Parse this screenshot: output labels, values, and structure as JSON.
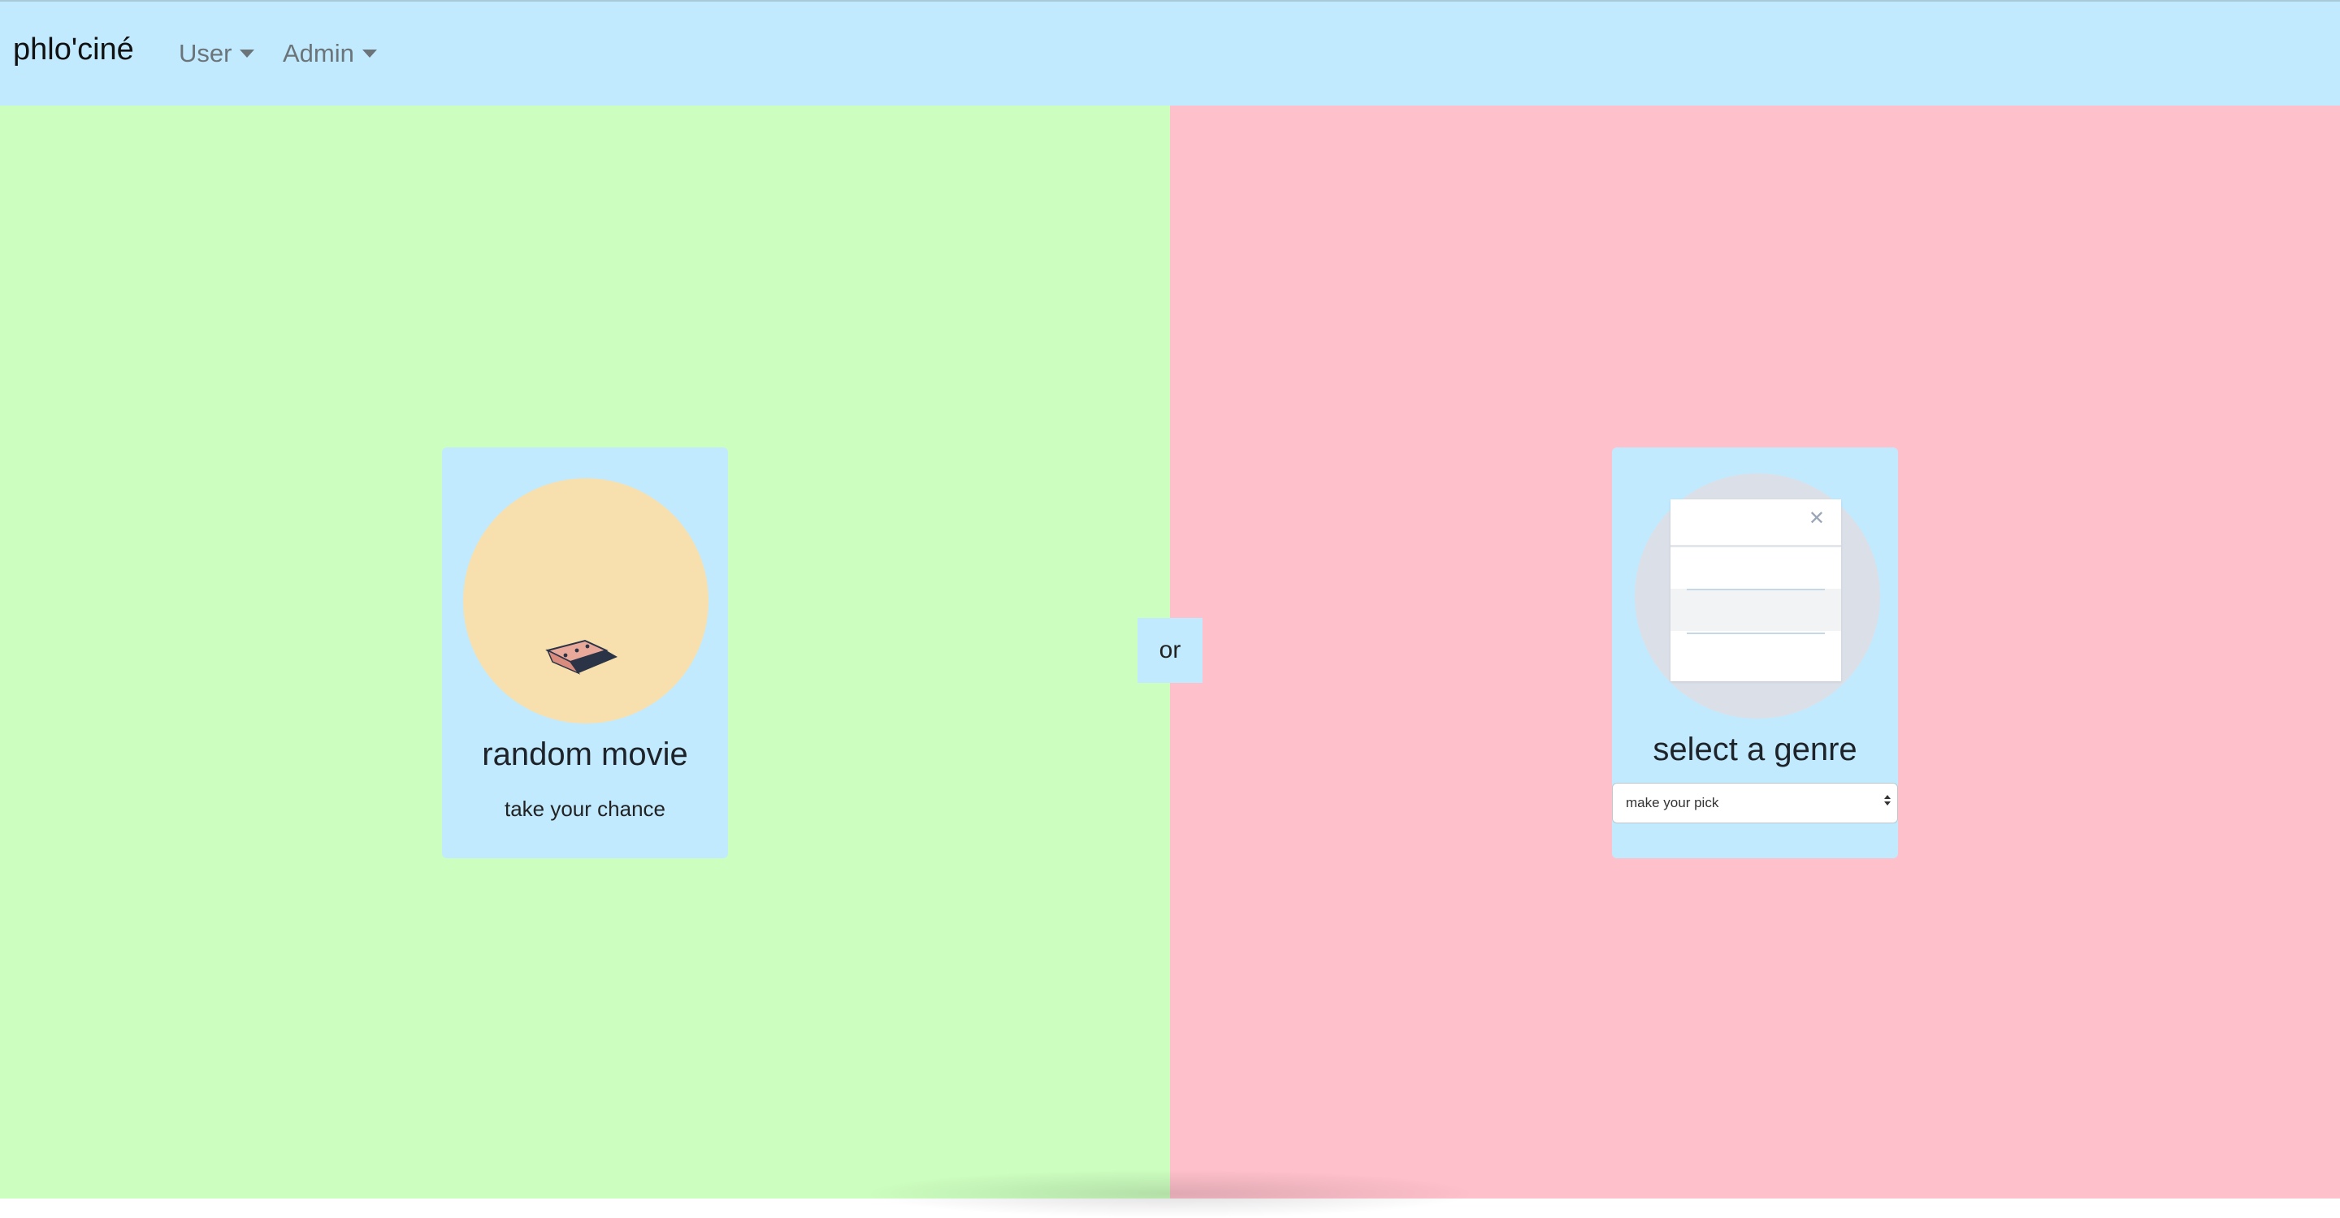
{
  "navbar": {
    "brand": "phlo'ciné",
    "menus": [
      {
        "label": "User"
      },
      {
        "label": "Admin"
      }
    ]
  },
  "colors": {
    "navbar_bg": "#c2eafe",
    "left_panel_bg": "#ccfebf",
    "right_panel_bg": "#fec0cb",
    "card_bg": "#c2eafe",
    "random_circle_bg": "#f7e0ad",
    "genre_circle_bg": "#dbe0e8"
  },
  "random_card": {
    "title": "random movie",
    "subtitle": "take your chance",
    "icon": "ticket-icon"
  },
  "separator": {
    "label": "or"
  },
  "genre_card": {
    "title": "select a genre",
    "icon": "dialog-illustration-icon",
    "select": {
      "placeholder": "make your pick"
    }
  }
}
